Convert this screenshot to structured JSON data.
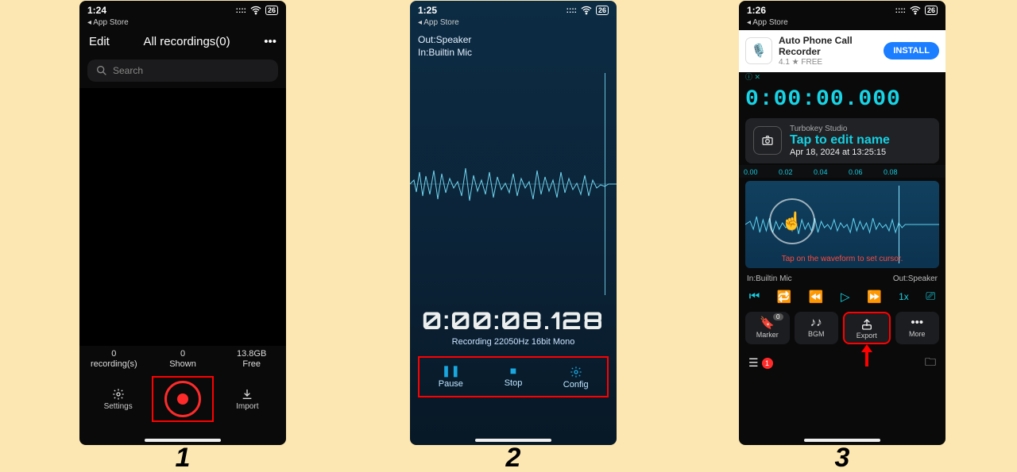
{
  "canvas": {
    "bg": "#fce7b2"
  },
  "steps": {
    "s1": "1",
    "s2": "2",
    "s3": "3"
  },
  "status": {
    "t1": "1:24",
    "t2": "1:25",
    "t3": "1:26",
    "crumb": "◂ App Store",
    "battery": "26",
    "sigdots": "::::"
  },
  "screen1": {
    "edit": "Edit",
    "title": "All recordings(0)",
    "more": "•••",
    "searchPlaceholder": "Search",
    "stats": {
      "recN": "0",
      "recL": "recording(s)",
      "shownN": "0",
      "shownL": "Shown",
      "freeN": "13.8GB",
      "freeL": "Free"
    },
    "tabs": {
      "settings": "Settings",
      "import": "Import"
    }
  },
  "screen2": {
    "outLabel": "Out:Speaker",
    "inLabel": "In:Builtin Mic",
    "timer": "0:00:08.128",
    "meta": "Recording 22050Hz 16bit Mono",
    "pause": "Pause",
    "stop": "Stop",
    "config": "Config"
  },
  "screen3": {
    "ad": {
      "name": "Auto Phone Call Recorder",
      "sub": "4.1 ★  FREE",
      "cta": "INSTALL",
      "badge": "ⓘ ✕"
    },
    "timer": "0:00:00.000",
    "studio": "Turbokey Studio",
    "title": "Tap to edit name",
    "date": "Apr 18, 2024 at 13:25:15",
    "ruler": [
      "0.00",
      "0.02",
      "0.04",
      "0.06",
      "0.08"
    ],
    "hint": "Tap on the waveform to set cursor.",
    "inLabel": "In:Builtin Mic",
    "outLabel": "Out:Speaker",
    "speed": "1x",
    "btns": {
      "marker": "Marker",
      "bgm": "BGM",
      "export": "Export",
      "more": "More"
    },
    "listCount": "1"
  }
}
